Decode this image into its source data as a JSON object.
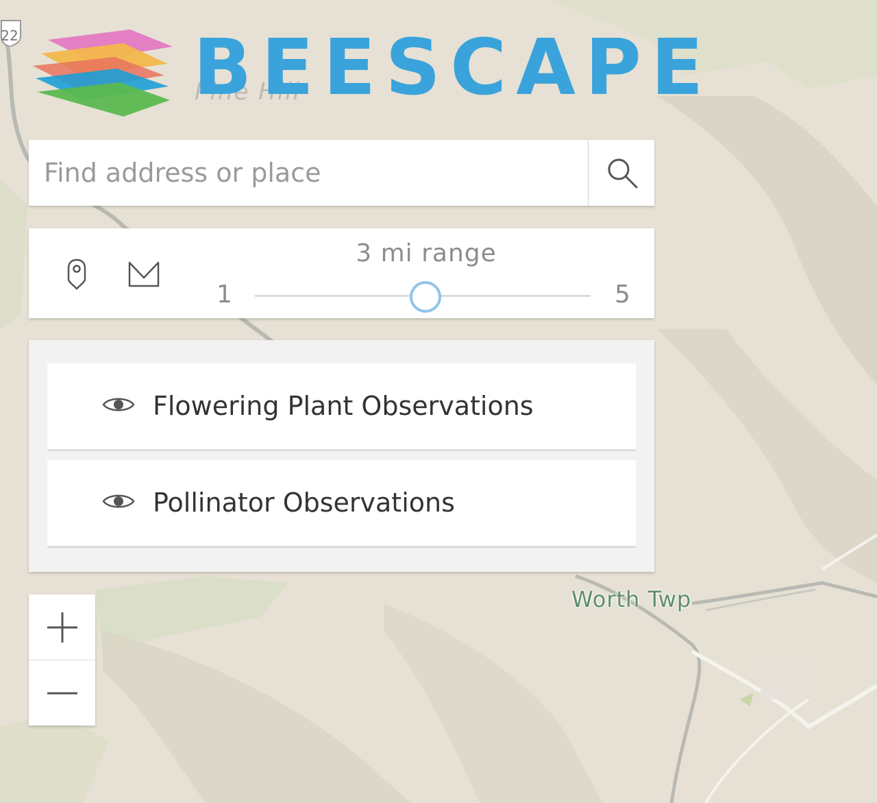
{
  "app": {
    "title": "BEESCAPE"
  },
  "map": {
    "place_label": "Worth Twp",
    "route_number": "22",
    "faint_label": "Pine Hill"
  },
  "search": {
    "placeholder": "Find address or place",
    "value": "",
    "button_icon": "search-icon"
  },
  "range": {
    "label": "3 mi range",
    "min": "1",
    "max": "5",
    "value": 3,
    "tools": [
      {
        "icon": "map-pin-icon"
      },
      {
        "icon": "envelope-icon"
      }
    ]
  },
  "layers": {
    "items": [
      {
        "label": "Flowering Plant Observations",
        "icon": "eye-icon",
        "visible": true
      },
      {
        "label": "Pollinator Observations",
        "icon": "eye-icon",
        "visible": true
      }
    ]
  },
  "zoom": {
    "in_icon": "plus-icon",
    "out_icon": "minus-icon"
  },
  "colors": {
    "brand": "#3aa3dc",
    "map_background": "#e6e1d4",
    "slider_thumb": "#92c3e8",
    "place_label": "#5e8f6e"
  }
}
